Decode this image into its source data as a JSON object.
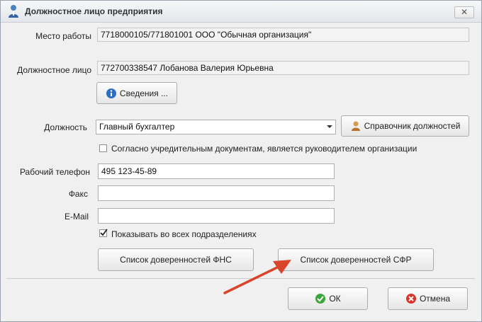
{
  "window": {
    "title": "Должностное лицо предприятия",
    "close_label": "✕"
  },
  "form": {
    "workplace": {
      "label": "Место работы",
      "value": "7718000105/771801001 ООО \"Обычная организация\""
    },
    "official": {
      "label": "Должностное лицо",
      "value": "772700338547 Лобанова Валерия Юрьевна"
    },
    "details_button": "Сведения ...",
    "position": {
      "label": "Должность",
      "value": "Главный бухгалтер"
    },
    "position_directory_button": "Справочник должностей",
    "is_head_checkbox": {
      "label": "Согласно учредительным документам, является руководителем организации",
      "checked": false
    },
    "work_phone": {
      "label": "Рабочий телефон",
      "value": "495 123-45-89"
    },
    "fax": {
      "label": "Факс",
      "value": ""
    },
    "email": {
      "label": "E-Mail",
      "value": ""
    },
    "show_all_checkbox": {
      "label": "Показывать во всех подразделениях",
      "checked": true
    },
    "fns_button": "Список доверенностей ФНС",
    "sfr_button": "Список доверенностей СФР"
  },
  "footer": {
    "ok_button": "ОК",
    "cancel_button": "Отмена"
  },
  "colors": {
    "annotation_arrow": "#d9442b",
    "ok_icon": "#3aa53a",
    "cancel_icon": "#d8322b",
    "info_icon": "#2c6fc2"
  }
}
